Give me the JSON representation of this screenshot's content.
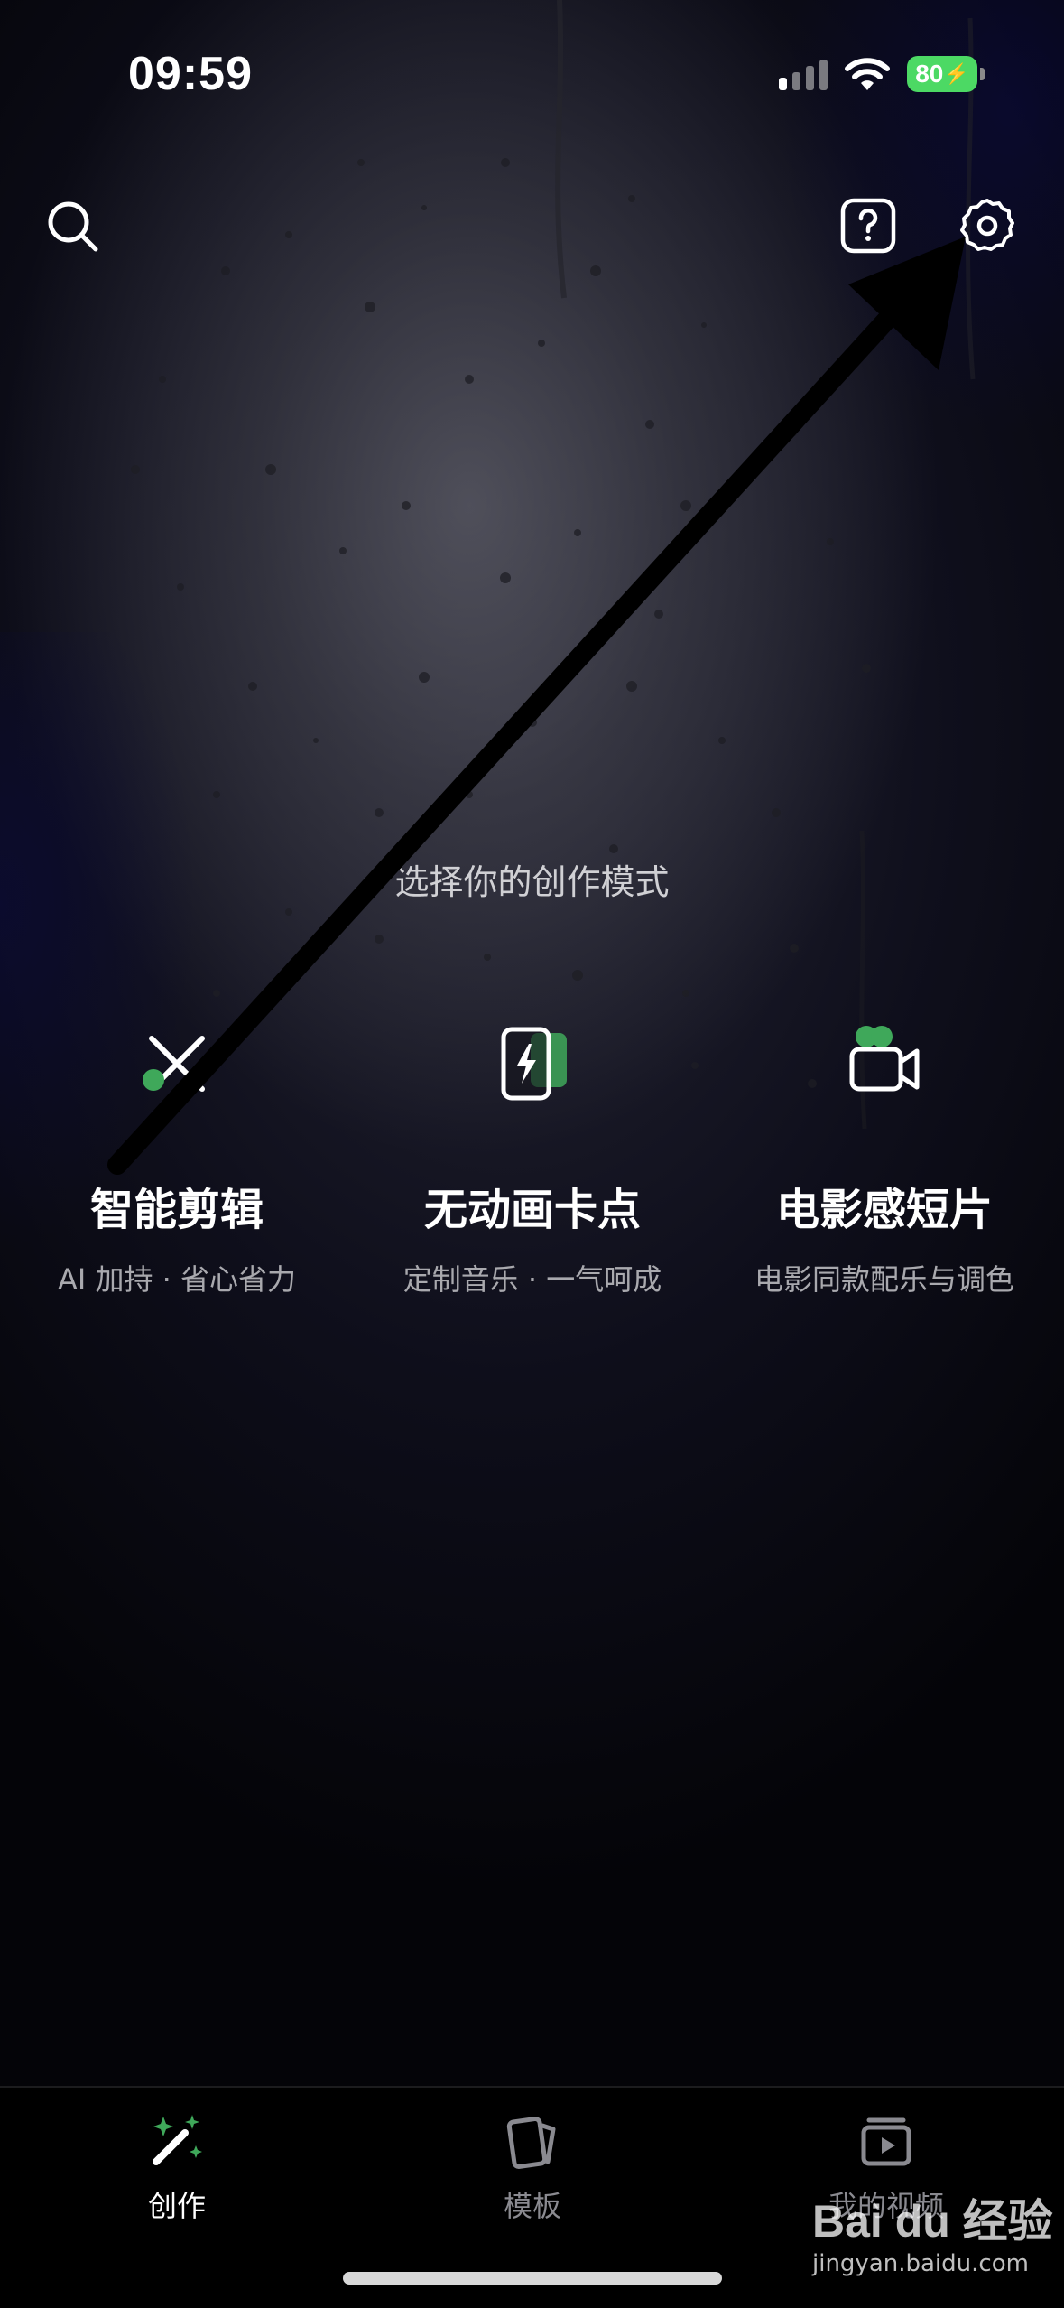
{
  "status_bar": {
    "time": "09:59",
    "battery": "80",
    "battery_color": "#4cd964"
  },
  "top_bar": {
    "search_icon": "search-icon",
    "help_icon": "help-icon",
    "settings_icon": "settings-gear-icon"
  },
  "main": {
    "title": "选择你的创作模式",
    "modes": [
      {
        "name": "智能剪辑",
        "desc": "AI 加持 · 省心省力",
        "icon": "scissors-icon"
      },
      {
        "name": "无动画卡点",
        "desc": "定制音乐 · 一气呵成",
        "icon": "flash-card-icon"
      },
      {
        "name": "电影感短片",
        "desc": "电影同款配乐与调色",
        "icon": "video-camera-icon"
      }
    ],
    "accent": "#3fa85a"
  },
  "bottom_nav": {
    "items": [
      {
        "label": "创作",
        "icon": "magic-wand-icon",
        "active": true
      },
      {
        "label": "模板",
        "icon": "template-cards-icon",
        "active": false
      },
      {
        "label": "我的视频",
        "icon": "my-videos-icon",
        "active": false
      }
    ]
  },
  "watermark": {
    "brand": "Bai du 经验",
    "url": "jingyan.baidu.com"
  }
}
